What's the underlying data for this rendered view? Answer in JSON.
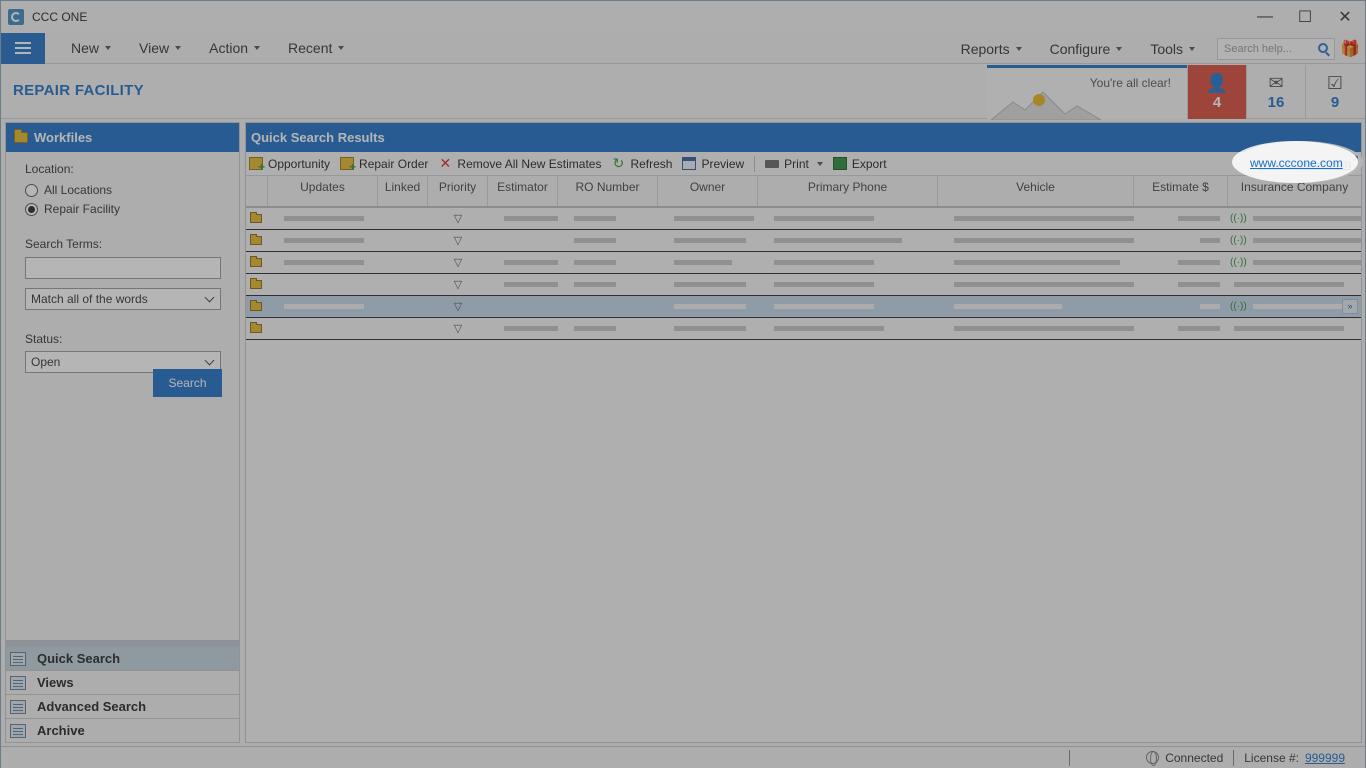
{
  "window": {
    "title": "CCC ONE",
    "controls": [
      "minimize",
      "maximize",
      "close"
    ]
  },
  "menubar": {
    "left": [
      "New",
      "View",
      "Action",
      "Recent"
    ],
    "right": [
      "Reports",
      "Configure",
      "Tools"
    ],
    "search_placeholder": "Search help..."
  },
  "header": {
    "title": "REPAIR FACILITY",
    "clear_message": "You're all clear!",
    "notifications": [
      {
        "name": "people",
        "count": "4",
        "glyph": "👤"
      },
      {
        "name": "messages",
        "count": "16",
        "glyph": "✉"
      },
      {
        "name": "tasks",
        "count": "9",
        "glyph": "☑"
      }
    ]
  },
  "left_panel": {
    "title": "Workfiles",
    "location_label": "Location:",
    "location_options": [
      "All Locations",
      "Repair Facility"
    ],
    "location_selected": "Repair Facility",
    "search_terms_label": "Search Terms:",
    "search_terms_value": "",
    "match_mode": "Match all of the words",
    "status_label": "Status:",
    "status_value": "Open",
    "search_button": "Search",
    "nav": [
      "Quick Search",
      "Views",
      "Advanced Search",
      "Archive"
    ],
    "nav_active": "Quick Search"
  },
  "results": {
    "title": "Quick Search Results",
    "toolbar": [
      "Opportunity",
      "Repair Order",
      "Remove All New Estimates",
      "Refresh",
      "Preview",
      "Print",
      "Export"
    ],
    "link": "www.cccone.com",
    "columns": [
      "Updates",
      "Linked",
      "Priority",
      "Estimator",
      "RO Number",
      "Owner",
      "Primary Phone",
      "Vehicle",
      "Estimate $",
      "Insurance Company"
    ],
    "row_count": 6,
    "selected_row": 5
  },
  "statusbar": {
    "connection": "Connected",
    "license_label": "License #:",
    "license_number": "999999"
  },
  "colors": {
    "accent": "#1c6fc6",
    "alert": "#d94a3a"
  }
}
